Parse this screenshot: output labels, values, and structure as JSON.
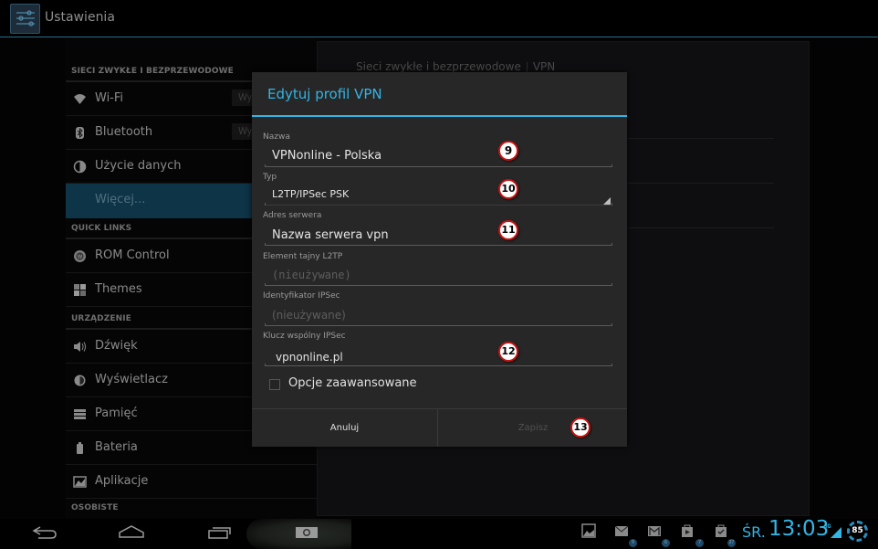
{
  "action_bar": {
    "title": "Ustawienia",
    "icon": "settings-sliders-icon"
  },
  "sidebar": {
    "sections": [
      {
        "header": "SIECI ZWYKŁE I BEZPRZEWODOWE"
      },
      {
        "header": "QUICK LINKS"
      },
      {
        "header": "URZĄDZENIE"
      },
      {
        "header": "OSOBISTE"
      }
    ],
    "items": [
      {
        "label": "Wi-Fi",
        "icon": "wifi-icon",
        "toggle": "Wy"
      },
      {
        "label": "Bluetooth",
        "icon": "bluetooth-icon",
        "toggle": "Wy"
      },
      {
        "label": "Użycie danych",
        "icon": "data-usage-icon"
      },
      {
        "label": "Więcej...",
        "selected": true
      },
      {
        "label": "ROM Control",
        "icon": "rom-control-icon"
      },
      {
        "label": "Themes",
        "icon": "themes-icon"
      },
      {
        "label": "Dźwięk",
        "icon": "sound-icon"
      },
      {
        "label": "Wyświetlacz",
        "icon": "display-icon"
      },
      {
        "label": "Pamięć",
        "icon": "storage-icon"
      },
      {
        "label": "Bateria",
        "icon": "battery-icon"
      },
      {
        "label": "Aplikacje",
        "icon": "apps-icon"
      }
    ]
  },
  "right_pane": {
    "breadcrumb": [
      "Sieci zwykłe i bezprzewodowe",
      "VPN"
    ]
  },
  "dialog": {
    "title": "Edytuj profil VPN",
    "fields": [
      {
        "label": "Nazwa",
        "value": "VPNonline - Polska",
        "marker": "9"
      },
      {
        "label": "Typ",
        "value": "L2TP/IPSec PSK",
        "marker": "10",
        "type": "spinner"
      },
      {
        "label": "Adres serwera",
        "value": "Nazwa serwera vpn",
        "marker": "11"
      },
      {
        "label": "Element tajny L2TP",
        "placeholder": "(nieużywane)"
      },
      {
        "label": "Identyfikator IPSec",
        "placeholder": "(nieużywane)"
      },
      {
        "label": "Klucz wspólny IPSec",
        "value": "vpnonline.pl",
        "marker": "12"
      }
    ],
    "advanced_checkbox": {
      "label": "Opcje zaawansowane",
      "checked": false
    },
    "buttons": {
      "cancel": "Anuluj",
      "save": "Zapisz",
      "save_marker": "13"
    }
  },
  "nav_bar": {
    "buttons": [
      "back",
      "home",
      "recent-apps",
      "screenshot"
    ]
  },
  "status_bar": {
    "notifications": [
      {
        "icon": "gallery-icon"
      },
      {
        "icon": "email-icon",
        "badge": "9"
      },
      {
        "icon": "gmail-icon",
        "badge": "6"
      },
      {
        "icon": "play-store-icon",
        "badge": "7"
      },
      {
        "icon": "store-update-icon",
        "badge": "27"
      }
    ],
    "day": "ŚR.",
    "time": "13:03",
    "network_type": "3G",
    "battery_level": "85",
    "accent_color": "#33b5e5"
  }
}
